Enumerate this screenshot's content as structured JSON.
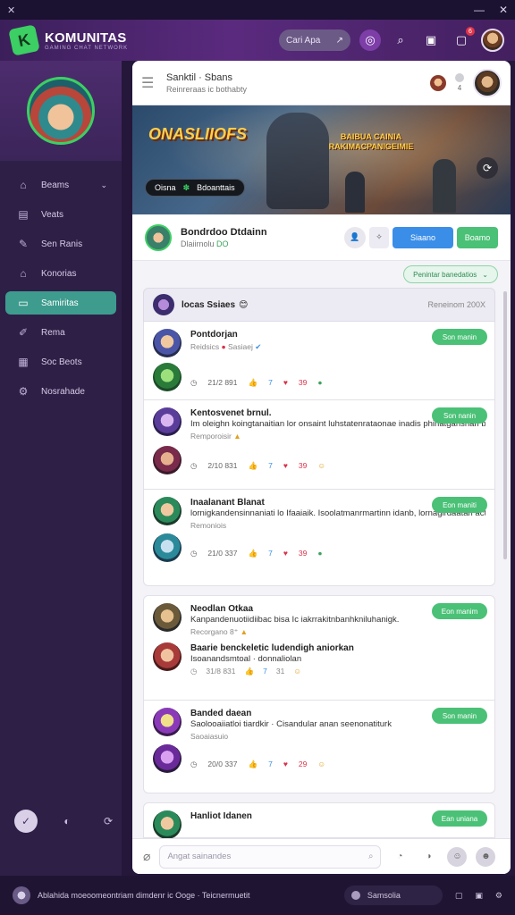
{
  "titlebar": {
    "app_glyph": "✕",
    "min": "—",
    "close": "✕"
  },
  "header": {
    "brand": "KOMUNITAS",
    "tagline": "GAMING CHAT NETWORK",
    "search_label": "Cari Apa",
    "notif_count": "6"
  },
  "sidebar": {
    "items": [
      {
        "label": "Beams",
        "icon": "home-icon",
        "glyph": "⌂",
        "active": false,
        "chevron": "⌄"
      },
      {
        "label": "Veats",
        "icon": "calendar-icon",
        "glyph": "▤",
        "active": false
      },
      {
        "label": "Sen Ranis",
        "icon": "pencil-icon",
        "glyph": "✎",
        "active": false
      },
      {
        "label": "Konorias",
        "icon": "store-icon",
        "glyph": "⌂",
        "active": false
      },
      {
        "label": "Samiritas",
        "icon": "chat-icon",
        "glyph": "▭",
        "active": true
      },
      {
        "label": "Rema",
        "icon": "edit-icon",
        "glyph": "✐",
        "active": false
      },
      {
        "label": "Soc Beots",
        "icon": "board-icon",
        "glyph": "▦",
        "active": false
      },
      {
        "label": "Nosrahade",
        "icon": "settings-icon",
        "glyph": "⚙",
        "active": false
      }
    ],
    "bottom": [
      "✓",
      "◐",
      "⟳"
    ]
  },
  "main": {
    "topbar": {
      "title": "Sanktil · Sbans",
      "subtitle": "Reinreraas ic bothabty",
      "counter": "4"
    },
    "banner": {
      "title_left": "ONASLIIOFS",
      "title_right": "BAIBUA CAINIA RAKIMACPANIGEIMIE",
      "pill_text": "Oisna",
      "pill_tag": "Bdoanttais"
    },
    "profile": {
      "name": "Bondrdoo Dtdainn",
      "status": "Dlaiirnolu",
      "status_highlight": "DO",
      "btn_icon": "✧",
      "btn_blue": "Siaano",
      "btn_green": "Boamo"
    },
    "filter": {
      "label": "Penintar banedatios"
    },
    "group": {
      "title": "locas Ssiaes",
      "emoji": "😊",
      "right": "Reneinom 200X"
    },
    "posts": [
      {
        "name": "Pontdorjan",
        "body": "",
        "meta": "Reidsics",
        "tag": "Sasiaej",
        "follow": "Son manin",
        "date": "21/2 891",
        "likes": "7",
        "hearts": "39"
      },
      {
        "name": "Kentosvenet brnul.",
        "body": "Im oleighn koingtanaitian lor onsaint luhstatenrataonae inadis phinatganshan batadanahaiiao neariopt.",
        "meta": "Remporoisir",
        "tag": "",
        "follow": "Son nanin",
        "date": "2/10 831",
        "likes": "7",
        "hearts": "39"
      },
      {
        "name": "Inaalanant Blanat",
        "body": "lornigkandensinnaniati lo Ifaaiaik. Isoolatmanrmartinn idanb, lornagirdaatari actis, oliolohaaiiobnroonigi.",
        "meta": "Remoniois",
        "tag": "",
        "follow": "Eon maniti",
        "date": "21/0 337",
        "likes": "7",
        "hearts": "39"
      },
      {
        "name": "Neodlan Otkaa",
        "body": "Kanpandenuotiidiibac bisa Ic iakrrakitnbanhkniluhanigk.",
        "meta": "Recorgano",
        "tag": "8⁺",
        "follow": "Eon manim",
        "date": "",
        "likes": "",
        "hearts": ""
      },
      {
        "name": "Baarie benckeletic ludendigh aniorkan",
        "body": "Isoanandsmtoal · donnaliolan",
        "meta": "",
        "tag": "",
        "follow": "",
        "date": "31/8 831",
        "likes": "7",
        "hearts": "31"
      },
      {
        "name": "Banded daean",
        "body": "Saolooaiiatloi tiardkir · Cisandular anan seenonatiturk",
        "meta": "Saoaiasuio",
        "tag": "",
        "follow": "Son manin",
        "date": "20/0 337",
        "likes": "7",
        "hearts": "29"
      },
      {
        "name": "Hanliot Idanen",
        "body": "",
        "meta": "",
        "tag": "",
        "follow": "Ean uniana",
        "date": "",
        "likes": "",
        "hearts": ""
      }
    ],
    "composer": {
      "placeholder": "Angat sainandes"
    }
  },
  "footer": {
    "status": "Ablahida moeoomeontriam dimdenr ic Ooge · Teicnermuetit",
    "search": "Samsolia"
  }
}
